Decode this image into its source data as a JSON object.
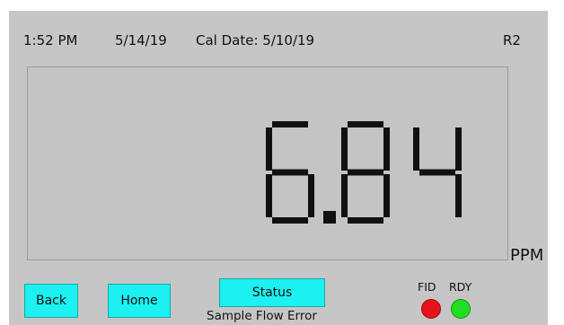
{
  "status_bar": {
    "time": "1:52 PM",
    "date": "5/14/19",
    "cal_date": "Cal Date: 5/10/19",
    "range": "R2"
  },
  "reading": {
    "value": "6.84",
    "units": "PPM"
  },
  "buttons": {
    "back": "Back",
    "home": "Home",
    "status": "Status"
  },
  "status_message": "Sample Flow Error",
  "indicators": [
    {
      "label": "FID",
      "color": "#e8121b",
      "state": "red"
    },
    {
      "label": "RDY",
      "color": "#22dd22",
      "state": "green"
    }
  ],
  "colors": {
    "screen_bg": "#c6c6c6",
    "button_bg": "#1cf0f0",
    "segment": "#111111"
  }
}
